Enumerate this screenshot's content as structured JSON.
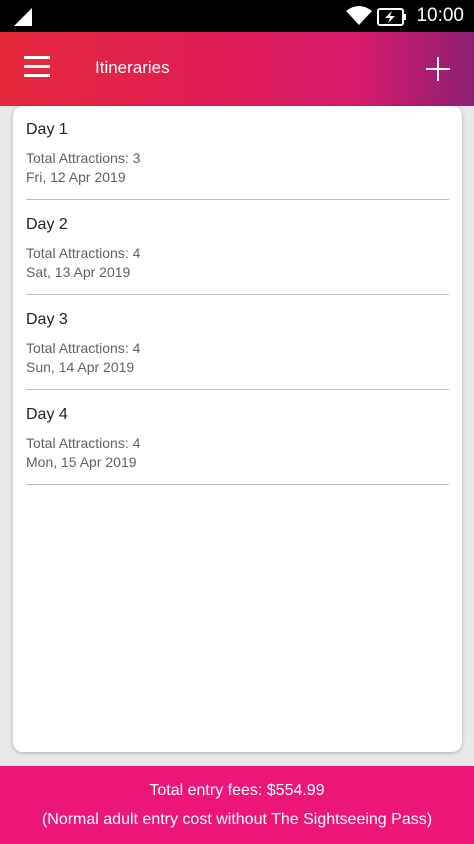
{
  "status_bar": {
    "time": "10:00",
    "icons": [
      "signal-icon",
      "wifi-icon",
      "battery-charging-icon"
    ]
  },
  "app_bar": {
    "title": "Itineraries",
    "menu_icon": "menu-icon",
    "add_icon": "plus-icon"
  },
  "days": [
    {
      "title": "Day 1",
      "attractions": "Total Attractions: 3",
      "date": "Fri, 12 Apr 2019"
    },
    {
      "title": "Day 2",
      "attractions": "Total Attractions: 4",
      "date": "Sat, 13 Apr 2019"
    },
    {
      "title": "Day 3",
      "attractions": "Total Attractions: 4",
      "date": "Sun, 14 Apr 2019"
    },
    {
      "title": "Day 4",
      "attractions": "Total Attractions: 4",
      "date": "Mon, 15 Apr 2019"
    }
  ],
  "footer": {
    "total_fees": "Total entry fees: $554.99",
    "note": "(Normal adult entry cost without The Sightseeing Pass)"
  },
  "colors": {
    "header_gradient_start": "#e5293a",
    "header_gradient_end": "#8c1f73",
    "footer_bg": "#ec1678",
    "card_bg": "#ffffff"
  }
}
